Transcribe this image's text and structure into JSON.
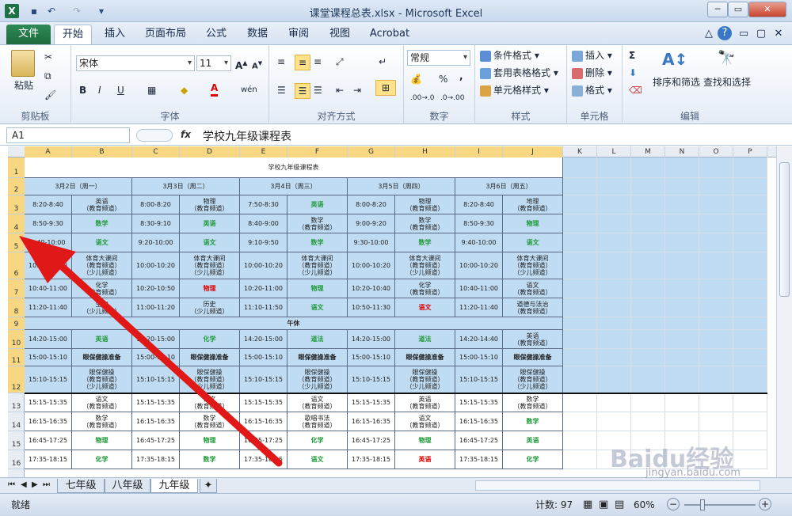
{
  "window": {
    "title": "课堂课程总表.xlsx - Microsoft Excel",
    "app_icon": "X",
    "minimize": "─",
    "restore": "▭",
    "close": "✕"
  },
  "qat": {
    "save_icon": "floppy-icon",
    "undo": "↶",
    "redo": "↷",
    "customize": "▾"
  },
  "tabs": [
    "文件",
    "开始",
    "插入",
    "页面布局",
    "公式",
    "数据",
    "审阅",
    "视图",
    "Acrobat"
  ],
  "tab_right_icons": [
    "△",
    "?",
    "▭",
    "▢",
    "✕"
  ],
  "ribbon": {
    "clipboard": {
      "label": "剪贴板",
      "paste": "粘贴"
    },
    "font": {
      "label": "字体",
      "family": "宋体",
      "size": "11",
      "bold": "B",
      "italic": "I",
      "underline": "U",
      "grow": "A↑",
      "shrink": "A↓",
      "wen": "wén",
      "font_color": "A"
    },
    "alignment": {
      "label": "对齐方式"
    },
    "number": {
      "label": "数字",
      "format": "常规",
      "percent": "%",
      "comma": ","
    },
    "styles": {
      "label": "样式",
      "items": [
        "条件格式",
        "套用表格格式",
        "单元格样式"
      ]
    },
    "cells": {
      "label": "单元格",
      "items": [
        "插入",
        "删除",
        "格式"
      ]
    },
    "editing": {
      "label": "编辑",
      "sum": "Σ",
      "sort": "排序和筛选",
      "find": "查找和选择"
    }
  },
  "formula_bar": {
    "name_box": "A1",
    "fx": "fx",
    "content": "学校九年级课程表"
  },
  "columns": [
    "A",
    "B",
    "C",
    "D",
    "E",
    "F",
    "G",
    "H",
    "I",
    "J",
    "K",
    "L",
    "M",
    "N",
    "O",
    "P"
  ],
  "rows": [
    "1",
    "2",
    "3",
    "4",
    "5",
    "6",
    "7",
    "8",
    "9",
    "10",
    "11",
    "12",
    "13",
    "14",
    "15",
    "16"
  ],
  "sheet": {
    "title": "学校九年级课程表",
    "days": [
      "3月2日（周一）",
      "3月3日（周二）",
      "3月4日（周三）",
      "3月5日（周四）",
      "3月6日（周五）"
    ],
    "lunch": "午休",
    "rows": [
      [
        [
          "8:20-8:40",
          ""
        ],
        [
          "英语\n（教育频道）",
          ""
        ],
        [
          "8:00-8:20",
          ""
        ],
        [
          "物理\n（教育频道）",
          ""
        ],
        [
          "7:50-8:30",
          ""
        ],
        [
          "英语",
          "g"
        ],
        [
          "8:00-8:20",
          ""
        ],
        [
          "物理\n（教育频道）",
          ""
        ],
        [
          "8:20-8:40",
          ""
        ],
        [
          "地理\n（教育频道）",
          ""
        ]
      ],
      [
        [
          "8:50-9:30",
          ""
        ],
        [
          "数学",
          "g"
        ],
        [
          "8:30-9:10",
          ""
        ],
        [
          "英语",
          "g"
        ],
        [
          "8:40-9:00",
          ""
        ],
        [
          "数学\n（教育频道）",
          ""
        ],
        [
          "9:00-9:20",
          ""
        ],
        [
          "数学\n（教育频道）",
          ""
        ],
        [
          "8:50-9:30",
          ""
        ],
        [
          "物理",
          "g"
        ]
      ],
      [
        [
          "9:40-10:00",
          ""
        ],
        [
          "语文",
          "g"
        ],
        [
          "9:20-10:00",
          ""
        ],
        [
          "语文",
          "g"
        ],
        [
          "9:10-9:50",
          ""
        ],
        [
          "数学",
          "g"
        ],
        [
          "9:30-10:00",
          ""
        ],
        [
          "数学",
          "g"
        ],
        [
          "9:40-10:00",
          ""
        ],
        [
          "语文",
          "g"
        ]
      ],
      [
        [
          "10:00-10:30",
          ""
        ],
        [
          "体育大课间\n（教育频道）\n（少儿频道）",
          ""
        ],
        [
          "10:00-10:20",
          ""
        ],
        [
          "体育大课间\n（教育频道）\n（少儿频道）",
          ""
        ],
        [
          "10:00-10:20",
          ""
        ],
        [
          "体育大课间\n（教育频道）\n（少儿频道）",
          ""
        ],
        [
          "10:00-10:20",
          ""
        ],
        [
          "体育大课间\n（教育频道）\n（少儿频道）",
          ""
        ],
        [
          "10:00-10:20",
          ""
        ],
        [
          "体育大课间\n（教育频道）\n（少儿频道）",
          ""
        ]
      ],
      [
        [
          "10:40-11:00",
          ""
        ],
        [
          "化学\n（教育频道）",
          ""
        ],
        [
          "10:20-10:50",
          ""
        ],
        [
          "物理",
          "r"
        ],
        [
          "10:20-11:00",
          ""
        ],
        [
          "物理",
          "g"
        ],
        [
          "10:20-10:40",
          ""
        ],
        [
          "化学\n（教育频道）",
          ""
        ],
        [
          "10:40-11:00",
          ""
        ],
        [
          "语文\n（教育频道）",
          ""
        ]
      ],
      [
        [
          "11:20-11:40",
          ""
        ],
        [
          "生物\n（少儿频道）",
          ""
        ],
        [
          "11:00-11:20",
          ""
        ],
        [
          "历史\n（少儿频道）",
          ""
        ],
        [
          "11:10-11:50",
          ""
        ],
        [
          "语文",
          "g"
        ],
        [
          "10:50-11:30",
          ""
        ],
        [
          "语文",
          "r"
        ],
        [
          "11:20-11:40",
          ""
        ],
        [
          "道德与法治\n（教育频道）",
          ""
        ]
      ],
      [
        [
          "14:20-15:00",
          ""
        ],
        [
          "英语",
          "g"
        ],
        [
          "14:20-15:00",
          ""
        ],
        [
          "化学",
          "g"
        ],
        [
          "14:20-15:00",
          ""
        ],
        [
          "道法",
          "g"
        ],
        [
          "14:20-15:00",
          ""
        ],
        [
          "道法",
          "g"
        ],
        [
          "14:20-14:40",
          ""
        ],
        [
          "英语\n（教育频道）",
          ""
        ]
      ],
      [
        [
          "15:00-15:10",
          ""
        ],
        [
          "眼保健操准备",
          "b"
        ],
        [
          "15:00-15:10",
          ""
        ],
        [
          "眼保健操准备",
          "b"
        ],
        [
          "15:00-15:10",
          ""
        ],
        [
          "眼保健操准备",
          "b"
        ],
        [
          "15:00-15:10",
          ""
        ],
        [
          "眼保健操准备",
          "b"
        ],
        [
          "15:00-15:10",
          ""
        ],
        [
          "眼保健操准备",
          "b"
        ]
      ],
      [
        [
          "15:10-15:15",
          ""
        ],
        [
          "眼保健操\n（教育频道）\n（少儿频道）",
          ""
        ],
        [
          "15:10-15:15",
          ""
        ],
        [
          "眼保健操\n（教育频道）\n（少儿频道）",
          ""
        ],
        [
          "15:10-15:15",
          ""
        ],
        [
          "眼保健操\n（教育频道）\n（少儿频道）",
          ""
        ],
        [
          "15:10-15:15",
          ""
        ],
        [
          "眼保健操\n（教育频道）\n（少儿频道）",
          ""
        ],
        [
          "15:10-15:15",
          ""
        ],
        [
          "眼保健操\n（教育频道）\n（少儿频道）",
          ""
        ]
      ],
      [
        [
          "15:15-15:35",
          ""
        ],
        [
          "语文\n（教育频道）",
          ""
        ],
        [
          "15:15-15:35",
          ""
        ],
        [
          "语文\n（教育频道）",
          ""
        ],
        [
          "15:15-15:35",
          ""
        ],
        [
          "语文\n（教育频道）",
          ""
        ],
        [
          "15:15-15:35",
          ""
        ],
        [
          "英语\n（教育频道）",
          ""
        ],
        [
          "15:15-15:35",
          ""
        ],
        [
          "数学\n（教育频道）",
          ""
        ]
      ],
      [
        [
          "16:15-16:35",
          ""
        ],
        [
          "数学\n（教育频道）",
          ""
        ],
        [
          "16:15-16:35",
          ""
        ],
        [
          "数学\n（教育频道）",
          ""
        ],
        [
          "16:15-16:35",
          ""
        ],
        [
          "歌唱书法\n（教育频道）",
          ""
        ],
        [
          "16:15-16:35",
          ""
        ],
        [
          "语文\n（教育频道）",
          ""
        ],
        [
          "16:15-16:35",
          ""
        ],
        [
          "数学",
          "g"
        ]
      ],
      [
        [
          "16:45-17:25",
          ""
        ],
        [
          "物理",
          "g"
        ],
        [
          "16:45-17:25",
          ""
        ],
        [
          "物理",
          "g"
        ],
        [
          "16:45-17:25",
          ""
        ],
        [
          "化学",
          "g"
        ],
        [
          "16:45-17:25",
          ""
        ],
        [
          "物理",
          "g"
        ],
        [
          "16:45-17:25",
          ""
        ],
        [
          "英语",
          "g"
        ]
      ],
      [
        [
          "17:35-18:15",
          ""
        ],
        [
          "化学",
          "g"
        ],
        [
          "17:35-18:15",
          ""
        ],
        [
          "数学",
          "g"
        ],
        [
          "17:35-18:15",
          ""
        ],
        [
          "语文",
          "g"
        ],
        [
          "17:35-18:15",
          ""
        ],
        [
          "英语",
          "r"
        ],
        [
          "17:35-18:15",
          ""
        ],
        [
          "化学",
          "g"
        ]
      ]
    ]
  },
  "sheet_tabs": [
    "七年级",
    "八年级",
    "九年级"
  ],
  "sheet_nav": [
    "⏮",
    "◀",
    "▶",
    "⏭"
  ],
  "status": {
    "ready": "就绪",
    "count": "计数: 97",
    "zoom": "60%",
    "minus": "−",
    "plus": "+"
  },
  "watermark": {
    "brand": "Baidu经验",
    "url": "jingyan.baidu.com"
  }
}
